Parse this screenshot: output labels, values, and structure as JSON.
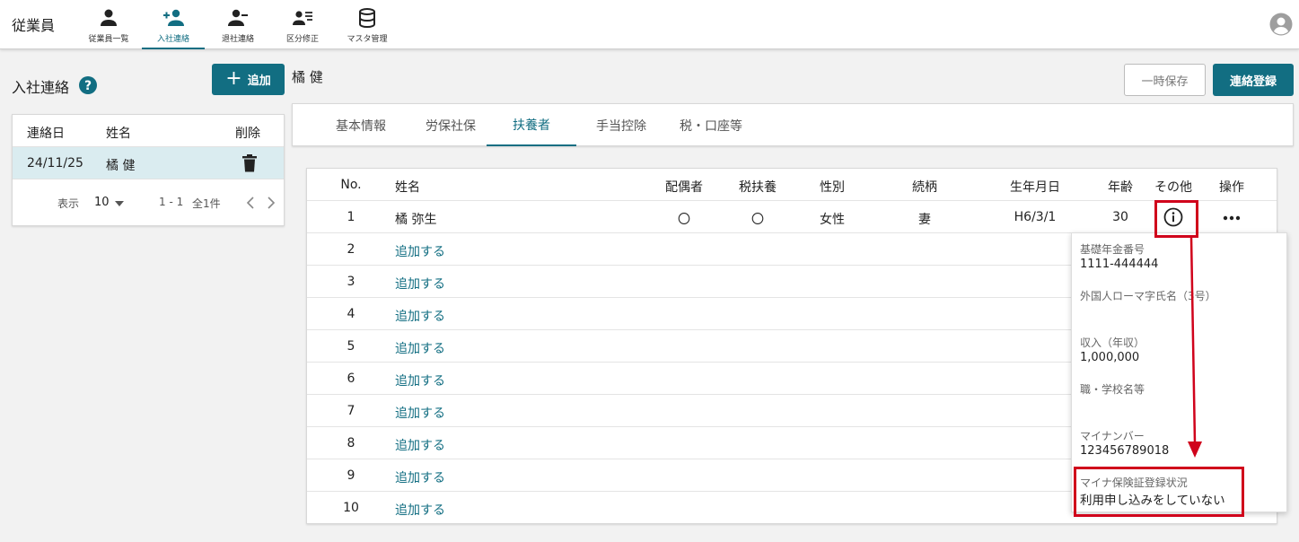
{
  "app_title": "従業員",
  "nav": [
    {
      "label": "従業員一覧",
      "icon": "person-icon"
    },
    {
      "label": "入社連絡",
      "icon": "person-add-icon"
    },
    {
      "label": "退社連絡",
      "icon": "person-remove-icon"
    },
    {
      "label": "区分修正",
      "icon": "person-list-icon"
    },
    {
      "label": "マスタ管理",
      "icon": "database-icon"
    }
  ],
  "colors": {
    "accent": "#126e82",
    "highlight": "#d0021b",
    "selected_row": "#daecf0"
  },
  "left_panel": {
    "heading": "入社連絡",
    "add_button": {
      "plus": "+",
      "label": "追加"
    },
    "columns": {
      "date": "連絡日",
      "name": "姓名",
      "delete": "削除"
    },
    "rows": [
      {
        "date": "24/11/25",
        "name": "橘 健"
      }
    ],
    "pager": {
      "display_label": "表示",
      "per_page": "10",
      "range": "1 - 1",
      "total": "全1件"
    }
  },
  "main": {
    "person_name": "橘 健",
    "temp_save_label": "一時保存",
    "register_label": "連絡登録",
    "tabs": [
      "基本情報",
      "労保社保",
      "扶養者",
      "手当控除",
      "税・口座等"
    ],
    "active_tab": "扶養者"
  },
  "dependents_table": {
    "columns": {
      "no": "No.",
      "name": "姓名",
      "spouse": "配偶者",
      "tax_dependent": "税扶養",
      "gender": "性別",
      "relation": "続柄",
      "birthdate": "生年月日",
      "age": "年齢",
      "other": "その他",
      "action": "操作"
    },
    "rows": [
      {
        "no": "1",
        "name": "橘 弥生",
        "spouse": "〇",
        "tax_dependent": "〇",
        "gender": "女性",
        "relation": "妻",
        "birthdate": "H6/3/1",
        "age": "30"
      },
      {
        "no": "2",
        "name": "追加する"
      },
      {
        "no": "3",
        "name": "追加する"
      },
      {
        "no": "4",
        "name": "追加する"
      },
      {
        "no": "5",
        "name": "追加する"
      },
      {
        "no": "6",
        "name": "追加する"
      },
      {
        "no": "7",
        "name": "追加する"
      },
      {
        "no": "8",
        "name": "追加する"
      },
      {
        "no": "9",
        "name": "追加する"
      },
      {
        "no": "10",
        "name": "追加する"
      }
    ]
  },
  "popup": {
    "pension_label": "基礎年金番号",
    "pension_value": "1111-444444",
    "roman_name_label": "外国人ローマ字氏名（3号）",
    "income_label": "収入（年収）",
    "income_value": "1,000,000",
    "job_label": "職・学校名等",
    "my_number_label": "マイナンバー",
    "my_number_value": "123456789018",
    "insurance_label": "マイナ保険証登録状況",
    "insurance_value": "利用申し込みをしていない"
  }
}
